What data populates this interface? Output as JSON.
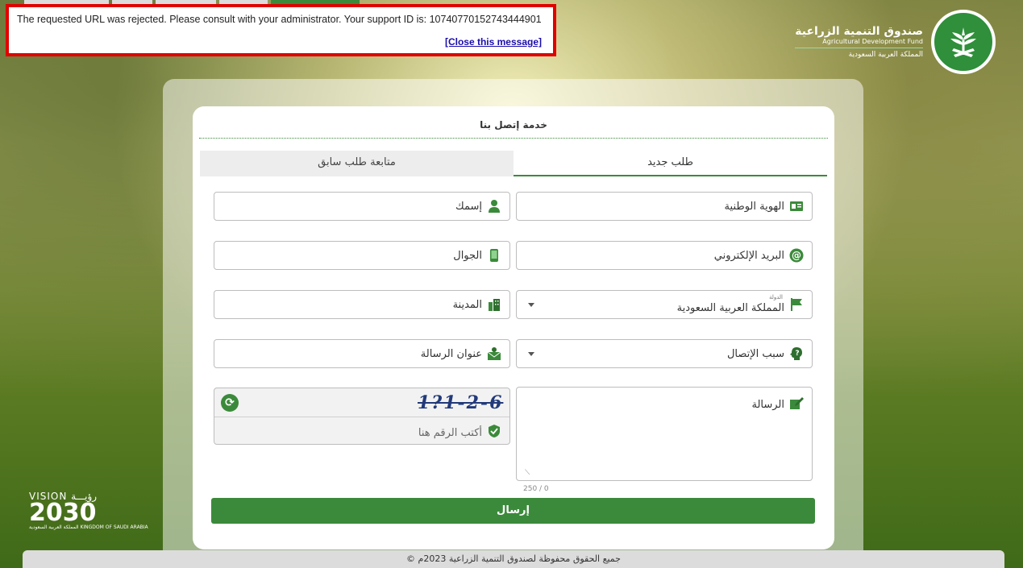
{
  "alert": {
    "message": "The requested URL was rejected. Please consult with your administrator. Your support ID is: 10740770152743444901",
    "close_label": "[Close this message]"
  },
  "logo": {
    "name_ar": "صندوق التنمية الزراعية",
    "name_en": "Agricultural Development Fund",
    "country_ar": "المملكة العربية السعودية"
  },
  "vision": {
    "line1": "VISION رؤيـــة",
    "year": "2030",
    "line3": "المملكة العربية السعودية KINGDOM OF SAUDI ARABIA"
  },
  "form": {
    "title": "خدمة إتصل بنا",
    "tabs": [
      {
        "label": "طلب جديد",
        "active": true
      },
      {
        "label": "متابعة طلب سابق",
        "active": false
      }
    ],
    "fields": {
      "national_id": "الهوية الوطنية",
      "name": "إسمك",
      "email": "البريد الإلكتروني",
      "mobile": "الجوال",
      "country_label": "الدولة",
      "country_value": "المملكة العربية السعودية",
      "city": "المدينة",
      "reason": "سبب الإتصال",
      "subject": "عنوان الرسالة",
      "message": "الرسالة",
      "captcha_placeholder": "أكتب الرقم هنا"
    },
    "captcha_code": "1?1-2-6",
    "counter": "250 / 0",
    "submit": "إرسال"
  },
  "footer": "© جميع الحقوق محفوظة لصندوق التنمية الزراعية 2023م",
  "colors": {
    "accent": "#3b8a3b",
    "alert_border": "#e00000"
  }
}
